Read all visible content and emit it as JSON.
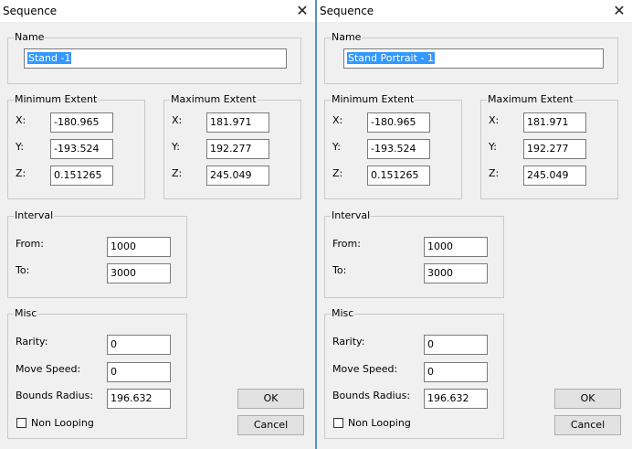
{
  "left": {
    "title": "Sequence",
    "close_glyph": "✕",
    "name_legend": "Name",
    "name_value": "Stand -1",
    "min_legend": "Minimum Extent",
    "min": {
      "x_label": "X:",
      "x": "-180.965",
      "y_label": "Y:",
      "y": "-193.524",
      "z_label": "Z:",
      "z": "0.151265"
    },
    "max_legend": "Maximum Extent",
    "max": {
      "x_label": "X:",
      "x": "181.971",
      "y_label": "Y:",
      "y": "192.277",
      "z_label": "Z:",
      "z": "245.049"
    },
    "interval_legend": "Interval",
    "from_label": "From:",
    "from": "1000",
    "to_label": "To:",
    "to": "3000",
    "misc_legend": "Misc",
    "rarity_label": "Rarity:",
    "rarity": "0",
    "move_speed_label": "Move Speed:",
    "move_speed": "0",
    "bounds_label": "Bounds Radius:",
    "bounds": "196.632",
    "non_looping_label": "Non Looping",
    "ok": "OK",
    "cancel": "Cancel"
  },
  "right": {
    "title": "Sequence",
    "close_glyph": "✕",
    "name_legend": "Name",
    "name_value": "Stand Portrait - 1",
    "min_legend": "Minimum Extent",
    "min": {
      "x_label": "X:",
      "x": "-180.965",
      "y_label": "Y:",
      "y": "-193.524",
      "z_label": "Z:",
      "z": "0.151265"
    },
    "max_legend": "Maximum Extent",
    "max": {
      "x_label": "X:",
      "x": "181.971",
      "y_label": "Y:",
      "y": "192.277",
      "z_label": "Z:",
      "z": "245.049"
    },
    "interval_legend": "Interval",
    "from_label": "From:",
    "from": "1000",
    "to_label": "To:",
    "to": "3000",
    "misc_legend": "Misc",
    "rarity_label": "Rarity:",
    "rarity": "0",
    "move_speed_label": "Move Speed:",
    "move_speed": "0",
    "bounds_label": "Bounds Radius:",
    "bounds": "196.632",
    "non_looping_label": "Non Looping",
    "ok": "OK",
    "cancel": "Cancel"
  }
}
